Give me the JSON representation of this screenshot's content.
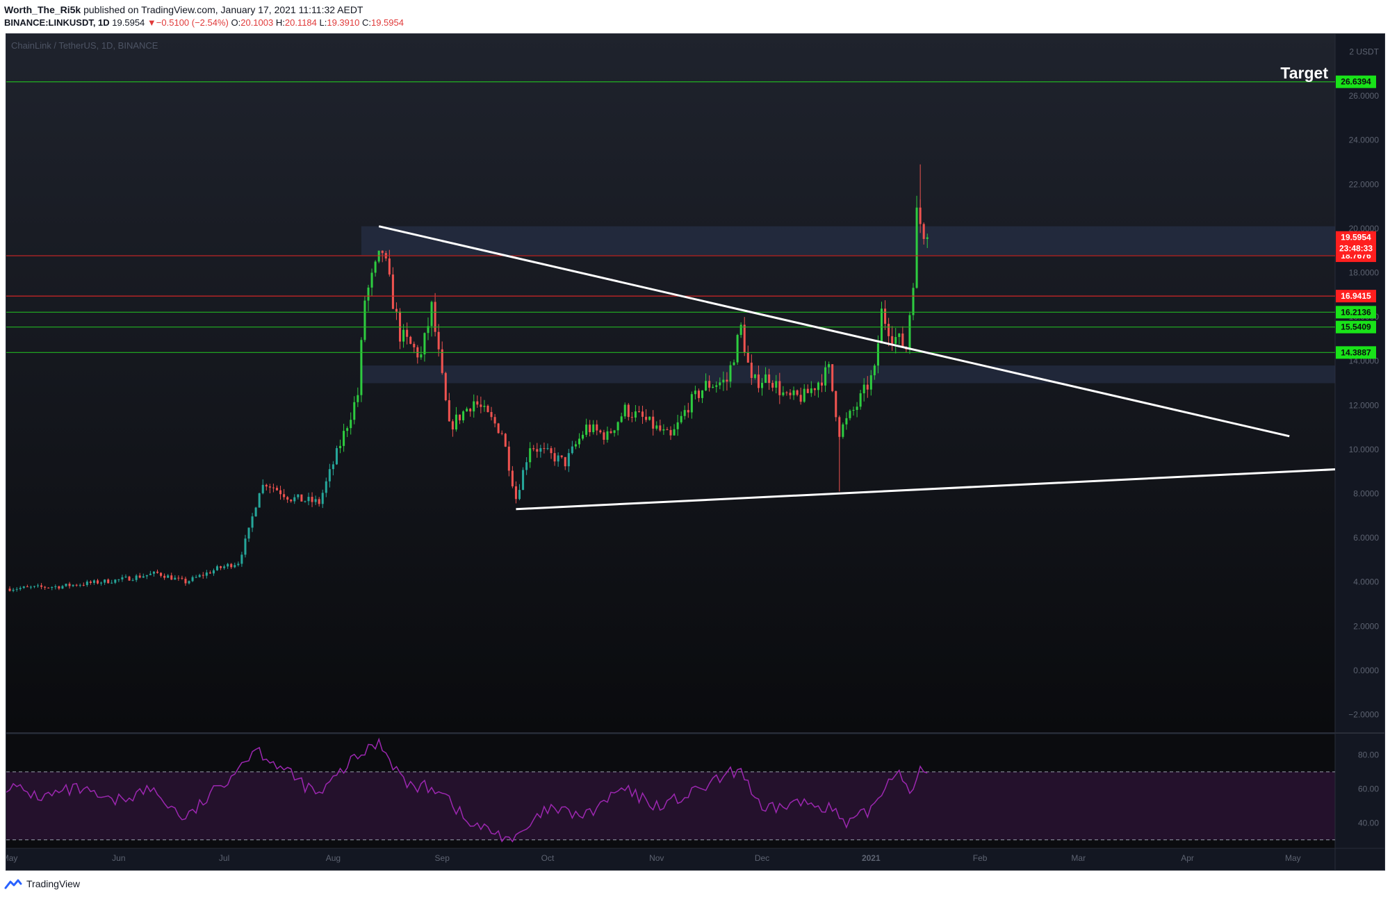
{
  "header": {
    "author": "Worth_The_Ri5k",
    "published": "published on TradingView.com, January 17, 2021 11:11:32 AEDT"
  },
  "symbol_line": {
    "symbol": "BINANCE:LINKUSDT, 1D",
    "last": "19.5954",
    "arrow": "▼",
    "change": "−0.5100 (−2.54%)",
    "o_label": "O:",
    "o": "20.1003",
    "h_label": "H:",
    "h": "20.1184",
    "l_label": "L:",
    "l": "19.3910",
    "c_label": "C:",
    "c": "19.5954"
  },
  "chart_title": "ChainLink / TetherUS, 1D, BINANCE",
  "annotation_target": "Target",
  "footer": {
    "brand": "TradingView"
  },
  "colors": {
    "background_top": "#1e222d",
    "background_bottom": "#0b0c0f",
    "up": "#26a69a",
    "up_bright": "#2ecc40",
    "down": "#ef5350",
    "support_line": "#22b422",
    "resistance_line": "#d02626",
    "trendline": "#ffffff",
    "zone": "#2a3550",
    "rsi": "#9c27b0",
    "label_red": "#ff1f1f",
    "label_green": "#19e319"
  },
  "chart_data": {
    "type": "candlestick",
    "title": "ChainLink / TetherUS, 1D, BINANCE",
    "ylabel": "USDT",
    "ylim": [
      -2.8,
      28.8
    ],
    "yticks": [
      "2 USDT",
      "26.0000",
      "24.0000",
      "22.0000",
      "20.0000",
      "18.0000",
      "16.0000",
      "14.0000",
      "12.0000",
      "10.0000",
      "8.0000",
      "6.0000",
      "4.0000",
      "2.0000",
      "0.0000",
      "−2.0000"
    ],
    "ytick_values": [
      28,
      26,
      24,
      22,
      20,
      18,
      16,
      14,
      12,
      10,
      8,
      6,
      4,
      2,
      0,
      -2
    ],
    "xticks": [
      "May",
      "Jun",
      "Jul",
      "Aug",
      "Sep",
      "Oct",
      "Nov",
      "Dec",
      "2021",
      "Feb",
      "Mar",
      "Apr",
      "May"
    ],
    "xtick_dates": [
      "2020-05-01",
      "2020-06-01",
      "2020-07-01",
      "2020-08-01",
      "2020-09-01",
      "2020-10-01",
      "2020-11-01",
      "2020-12-01",
      "2021-01-01",
      "2021-02-01",
      "2021-03-01",
      "2021-04-01",
      "2021-05-01"
    ],
    "xlim": [
      "2020-04-30",
      "2021-05-13"
    ],
    "price_path": [
      [
        "2020-04-30",
        3.7
      ],
      [
        "2020-05-15",
        3.8
      ],
      [
        "2020-06-01",
        4.1
      ],
      [
        "2020-06-12",
        4.4
      ],
      [
        "2020-06-20",
        4.0
      ],
      [
        "2020-06-29",
        4.6
      ],
      [
        "2020-07-05",
        4.9
      ],
      [
        "2020-07-08",
        6.3
      ],
      [
        "2020-07-11",
        8.2
      ],
      [
        "2020-07-13",
        8.5
      ],
      [
        "2020-07-20",
        7.8
      ],
      [
        "2020-07-28",
        7.6
      ],
      [
        "2020-08-02",
        9.8
      ],
      [
        "2020-08-08",
        12.5
      ],
      [
        "2020-08-10",
        16.8
      ],
      [
        "2020-08-15",
        19.0
      ],
      [
        "2020-08-20",
        15.2
      ],
      [
        "2020-08-26",
        14.2
      ],
      [
        "2020-08-29",
        16.4
      ],
      [
        "2020-09-03",
        11.0
      ],
      [
        "2020-09-10",
        12.2
      ],
      [
        "2020-09-18",
        10.8
      ],
      [
        "2020-09-22",
        7.8
      ],
      [
        "2020-09-26",
        10.2
      ],
      [
        "2020-10-06",
        9.4
      ],
      [
        "2020-10-12",
        11.0
      ],
      [
        "2020-10-18",
        10.6
      ],
      [
        "2020-10-23",
        11.8
      ],
      [
        "2020-10-28",
        11.4
      ],
      [
        "2020-11-05",
        10.5
      ],
      [
        "2020-11-10",
        12.0
      ],
      [
        "2020-11-15",
        12.9
      ],
      [
        "2020-11-21",
        13.1
      ],
      [
        "2020-11-25",
        15.5
      ],
      [
        "2020-11-28",
        13.0
      ],
      [
        "2020-12-03",
        13.3
      ],
      [
        "2020-12-08",
        12.3
      ],
      [
        "2020-12-13",
        12.4
      ],
      [
        "2020-12-16",
        12.9
      ],
      [
        "2020-12-20",
        13.6
      ],
      [
        "2020-12-23",
        10.8
      ],
      [
        "2020-12-28",
        12.0
      ],
      [
        "2021-01-02",
        13.5
      ],
      [
        "2021-01-04",
        16.2
      ],
      [
        "2021-01-07",
        15.2
      ],
      [
        "2021-01-11",
        14.6
      ],
      [
        "2021-01-13",
        17.8
      ],
      [
        "2021-01-14",
        20.6
      ],
      [
        "2021-01-17",
        19.6
      ]
    ],
    "wick_extremes": {
      "high": 22.9,
      "low": 8.1
    },
    "horizontal_lines": [
      {
        "value": 26.6394,
        "label": "26.6394",
        "color": "green"
      },
      {
        "value": 18.7676,
        "label": "18.7676",
        "color": "red"
      },
      {
        "value": 16.9415,
        "label": "16.9415",
        "color": "red"
      },
      {
        "value": 16.2136,
        "label": "16.2136",
        "color": "green"
      },
      {
        "value": 15.5409,
        "label": "15.5409",
        "color": "green"
      },
      {
        "value": 14.3887,
        "label": "14.3887",
        "color": "green"
      }
    ],
    "price_labels": [
      {
        "value": 19.5954,
        "label": "19.5954",
        "color": "red"
      },
      {
        "value": 19.1,
        "label": "23:48:33",
        "color": "red"
      }
    ],
    "zones": [
      {
        "from_date": "2020-08-09",
        "y_low": 18.8,
        "y_high": 20.1
      },
      {
        "from_date": "2020-08-09",
        "y_low": 13.0,
        "y_high": 13.8
      }
    ],
    "trendlines": [
      {
        "from": [
          "2020-08-14",
          20.1
        ],
        "to": [
          "2021-04-30",
          10.6
        ]
      },
      {
        "from": [
          "2020-09-22",
          7.3
        ],
        "to": [
          "2021-05-13",
          9.1
        ]
      }
    ],
    "rsi": {
      "ylim": [
        25,
        92
      ],
      "yticks": [
        "80.00",
        "60.00",
        "40.00"
      ],
      "ytick_values": [
        80,
        60,
        40
      ],
      "bands": [
        70,
        30
      ],
      "path": [
        [
          "2020-04-30",
          62
        ],
        [
          "2020-05-10",
          55
        ],
        [
          "2020-05-20",
          60
        ],
        [
          "2020-05-30",
          52
        ],
        [
          "2020-06-10",
          60
        ],
        [
          "2020-06-20",
          42
        ],
        [
          "2020-06-30",
          62
        ],
        [
          "2020-07-10",
          84
        ],
        [
          "2020-07-20",
          68
        ],
        [
          "2020-07-28",
          56
        ],
        [
          "2020-08-05",
          74
        ],
        [
          "2020-08-14",
          88
        ],
        [
          "2020-08-22",
          62
        ],
        [
          "2020-09-01",
          60
        ],
        [
          "2020-09-08",
          40
        ],
        [
          "2020-09-22",
          30
        ],
        [
          "2020-10-01",
          48
        ],
        [
          "2020-10-12",
          44
        ],
        [
          "2020-10-22",
          60
        ],
        [
          "2020-11-01",
          50
        ],
        [
          "2020-11-10",
          56
        ],
        [
          "2020-11-25",
          72
        ],
        [
          "2020-12-01",
          46
        ],
        [
          "2020-12-10",
          52
        ],
        [
          "2020-12-20",
          50
        ],
        [
          "2020-12-25",
          38
        ],
        [
          "2021-01-01",
          48
        ],
        [
          "2021-01-08",
          72
        ],
        [
          "2021-01-12",
          60
        ],
        [
          "2021-01-15",
          70
        ],
        [
          "2021-01-17",
          66
        ]
      ]
    }
  }
}
